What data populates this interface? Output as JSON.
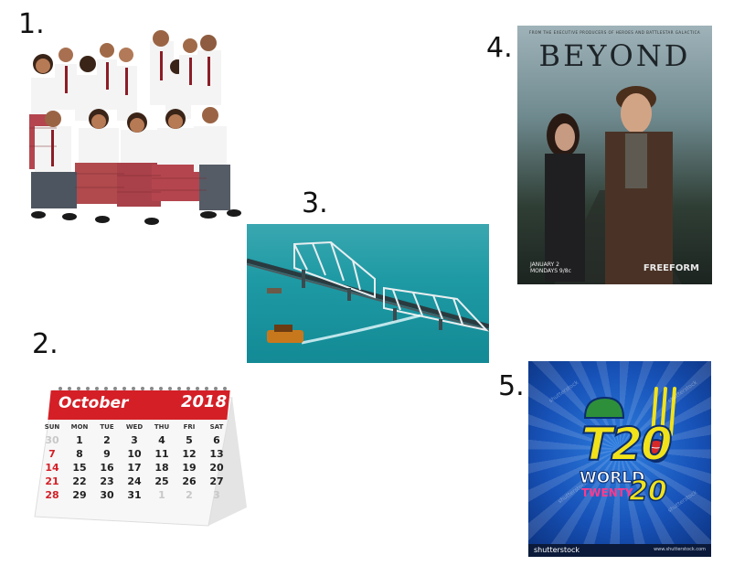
{
  "labels": {
    "one": "1.",
    "two": "2.",
    "three": "3.",
    "four": "4.",
    "five": "5."
  },
  "poster": {
    "tagline": "FROM THE EXECUTIVE PRODUCERS OF HEROES AND BATTLESTAR GALACTICA",
    "title": "BEYOND",
    "date_line1": "JANUARY 2",
    "date_line2": "MONDAYS 9/8c",
    "network": "FREEFORM"
  },
  "calendar": {
    "month": "October",
    "year": "2018",
    "days_of_week": [
      "SUN",
      "MON",
      "TUE",
      "WED",
      "THU",
      "FRI",
      "SAT"
    ],
    "weeks": [
      [
        "30",
        "1",
        "2",
        "3",
        "4",
        "5",
        "6"
      ],
      [
        "7",
        "8",
        "9",
        "10",
        "11",
        "12",
        "13"
      ],
      [
        "14",
        "15",
        "16",
        "17",
        "18",
        "19",
        "20"
      ],
      [
        "21",
        "22",
        "23",
        "24",
        "25",
        "26",
        "27"
      ],
      [
        "28",
        "29",
        "30",
        "31",
        "1",
        "2",
        "3"
      ]
    ]
  },
  "t20": {
    "main": "T20",
    "world": "WORLD",
    "twenty": "TWENTY",
    "twenty_num": "20",
    "watermark": "shutterstock",
    "footer_logo": "shutterstock",
    "footer_id": "www.shutterstock.com"
  }
}
